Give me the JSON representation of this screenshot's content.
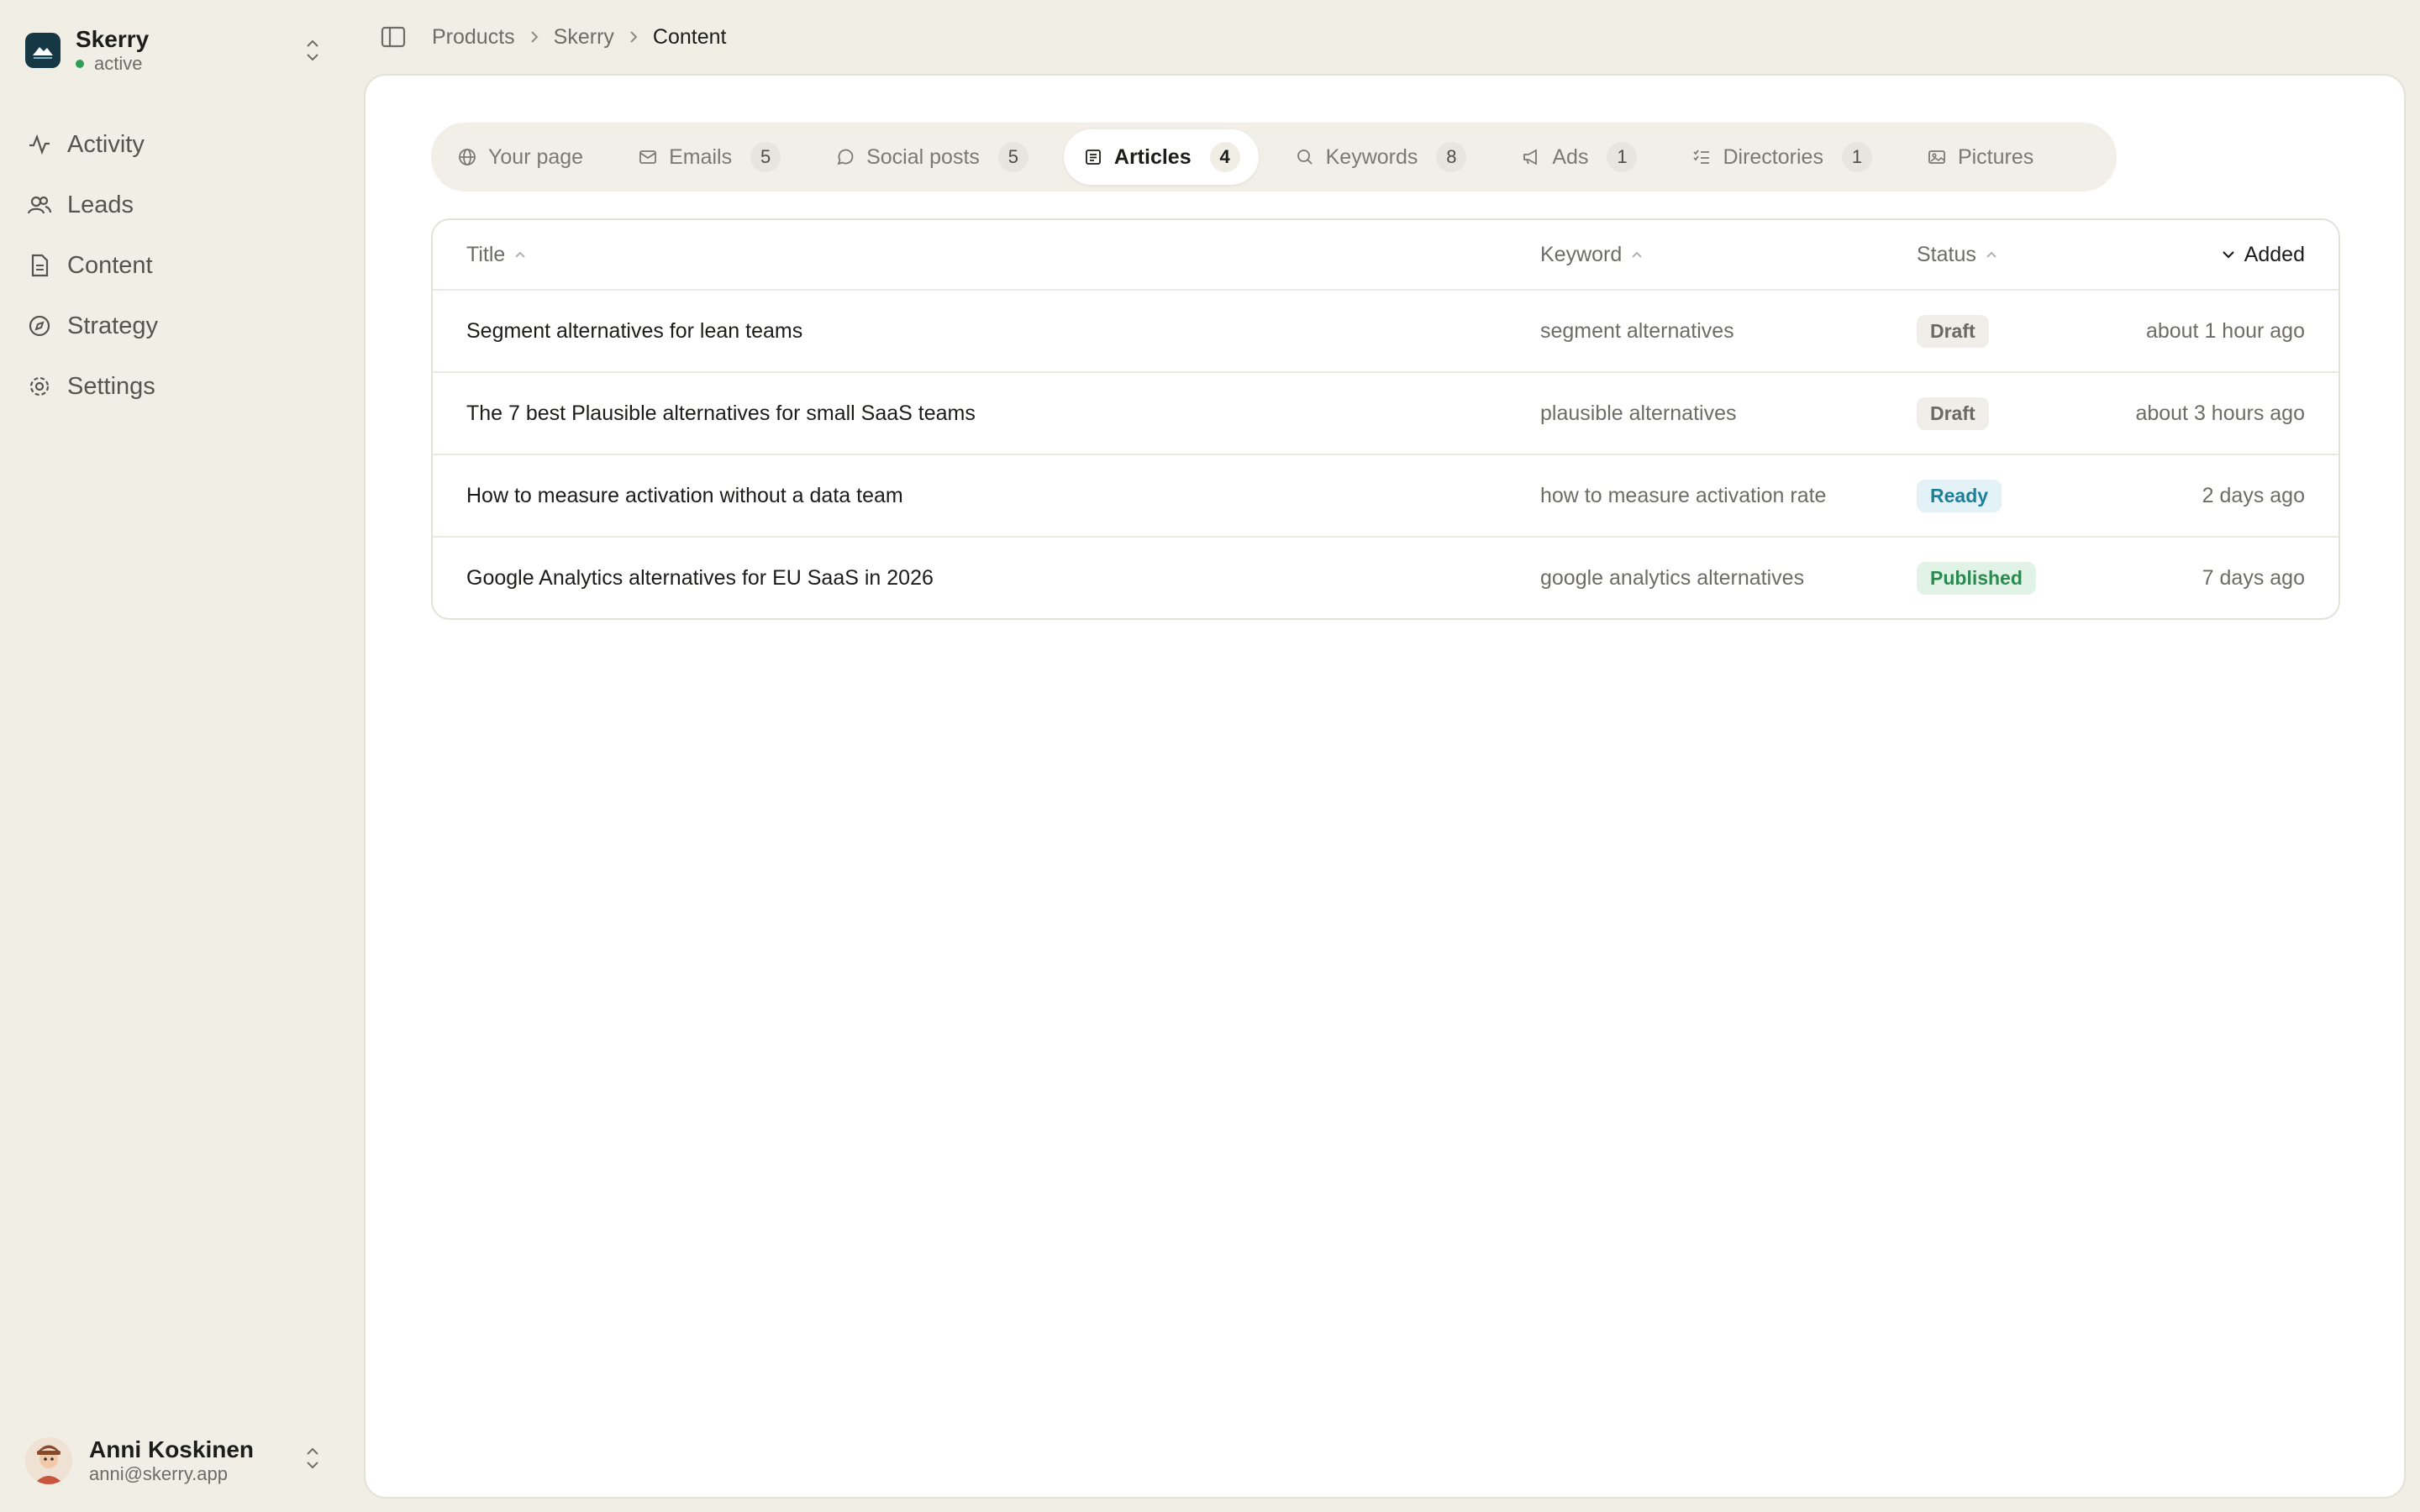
{
  "colors": {
    "accent": "#163844",
    "active_dot": "#2f9e55",
    "ready": "#1d7f99",
    "published": "#2b8a4e"
  },
  "workspace": {
    "name": "Skerry",
    "status": "active",
    "logo_icon": "mountain-logo-icon"
  },
  "nav": [
    {
      "label": "Activity",
      "icon": "activity-icon"
    },
    {
      "label": "Leads",
      "icon": "users-icon"
    },
    {
      "label": "Content",
      "icon": "file-icon"
    },
    {
      "label": "Strategy",
      "icon": "compass-icon"
    },
    {
      "label": "Settings",
      "icon": "gear-icon"
    }
  ],
  "user": {
    "name": "Anni Koskinen",
    "email": "anni@skerry.app"
  },
  "breadcrumb": [
    "Products",
    "Skerry",
    "Content"
  ],
  "tabs": [
    {
      "label": "Your page",
      "count": "",
      "icon": "globe-icon"
    },
    {
      "label": "Emails",
      "count": "5",
      "icon": "mail-icon"
    },
    {
      "label": "Social posts",
      "count": "5",
      "icon": "chat-icon"
    },
    {
      "label": "Articles",
      "count": "4",
      "icon": "document-icon",
      "active": true
    },
    {
      "label": "Keywords",
      "count": "8",
      "icon": "search-icon"
    },
    {
      "label": "Ads",
      "count": "1",
      "icon": "megaphone-icon"
    },
    {
      "label": "Directories",
      "count": "1",
      "icon": "list-check-icon"
    },
    {
      "label": "Pictures",
      "count": "",
      "icon": "image-icon"
    }
  ],
  "table": {
    "columns": {
      "title": "Title",
      "keyword": "Keyword",
      "status": "Status",
      "added": "Added"
    },
    "rows": [
      {
        "title": "Segment alternatives for lean teams",
        "keyword": "segment alternatives",
        "status": "Draft",
        "added": "about 1 hour ago"
      },
      {
        "title": "The 7 best Plausible alternatives for small SaaS teams",
        "keyword": "plausible alternatives",
        "status": "Draft",
        "added": "about 3 hours ago"
      },
      {
        "title": "How to measure activation without a data team",
        "keyword": "how to measure activation rate",
        "status": "Ready",
        "added": "2 days ago"
      },
      {
        "title": "Google Analytics alternatives for EU SaaS in 2026",
        "keyword": "google analytics alternatives",
        "status": "Published",
        "added": "7 days ago"
      }
    ]
  }
}
